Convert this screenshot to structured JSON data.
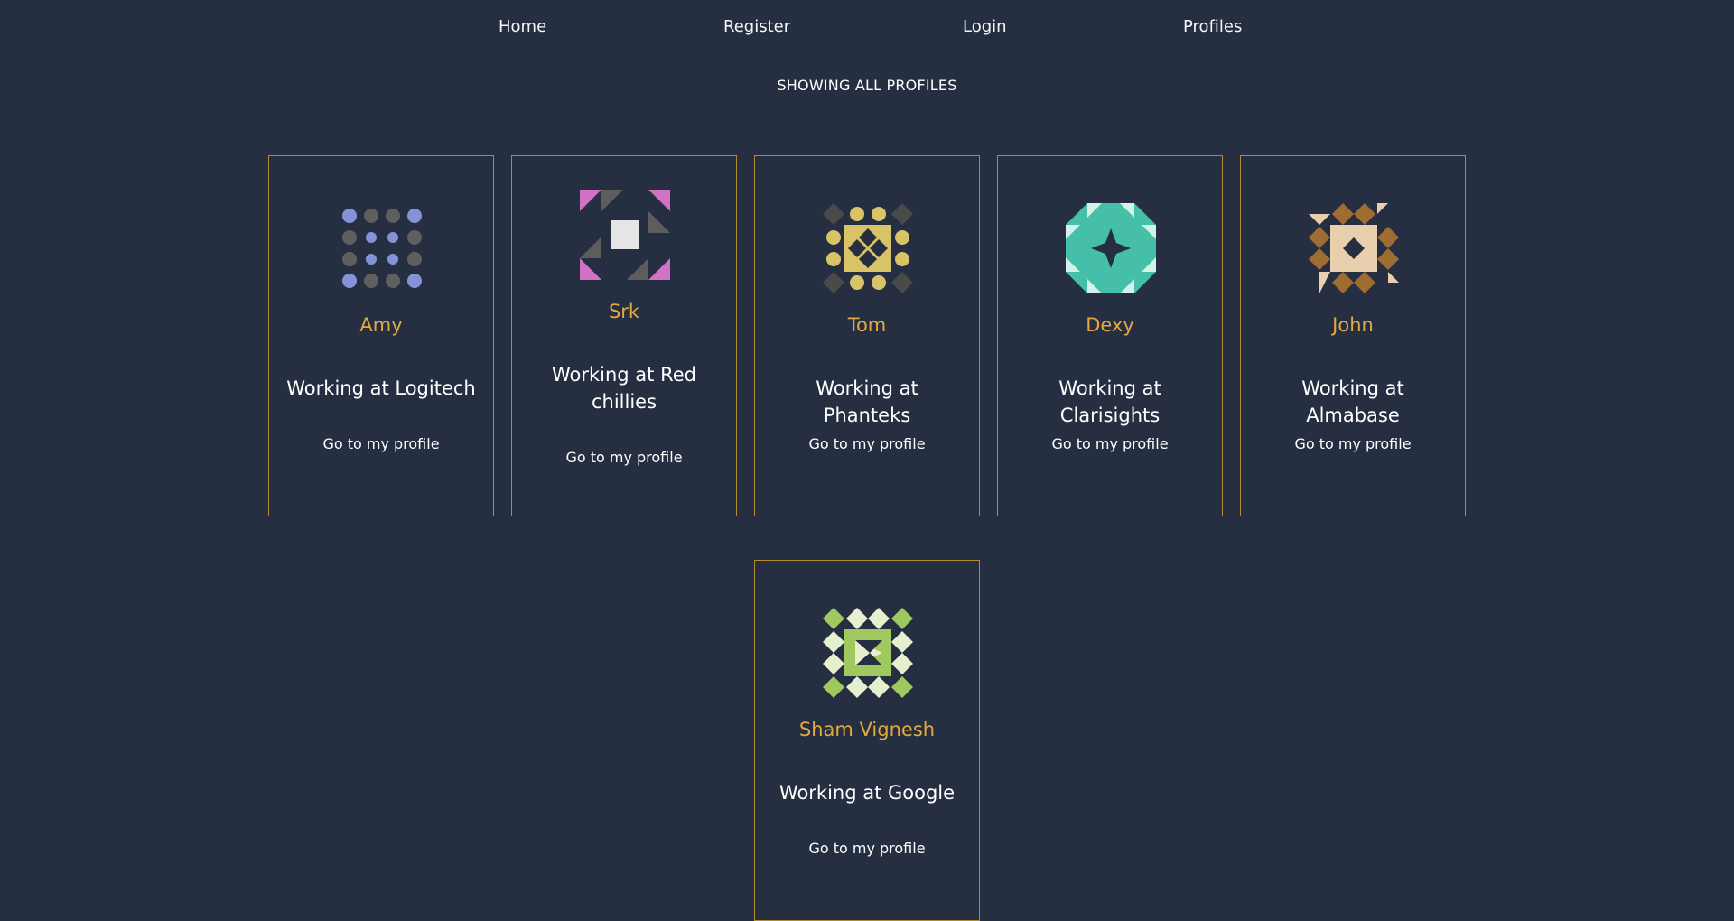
{
  "nav": {
    "home": "Home",
    "register": "Register",
    "login": "Login",
    "profiles": "Profiles"
  },
  "page": {
    "heading": "SHOWING ALL PROFILES"
  },
  "profiles": [
    {
      "name": "Amy",
      "work": "Working at Logitech",
      "link": "Go to my profile",
      "avatar_icon": "dots-pattern-icon",
      "colors": [
        "#8592d6",
        "#5f5f5f"
      ]
    },
    {
      "name": "Srk",
      "work": "Working at Red chillies",
      "link": "Go to my profile",
      "avatar_icon": "triangle-square-pattern-icon",
      "colors": [
        "#d272c4",
        "#5d5d5d",
        "#e5e5e5"
      ]
    },
    {
      "name": "Tom",
      "work": "Working at Phanteks",
      "link": "Go to my profile",
      "avatar_icon": "diamond-dot-pattern-icon",
      "colors": [
        "#d8c466",
        "#4a4a4a"
      ]
    },
    {
      "name": "Dexy",
      "work": "Working at Clarisights",
      "link": "Go to my profile",
      "avatar_icon": "star-triangle-pattern-icon",
      "colors": [
        "#46bfa8",
        "#d3f2ea"
      ]
    },
    {
      "name": "John",
      "work": "Working at Almabase",
      "link": "Go to my profile",
      "avatar_icon": "diamond-triangle-pattern-icon",
      "colors": [
        "#9d6d32",
        "#e8cfae"
      ]
    },
    {
      "name": "Sham Vignesh",
      "work": "Working at Google",
      "link": "Go to my profile",
      "avatar_icon": "green-diamond-pattern-icon",
      "colors": [
        "#9fc95f",
        "#e6f0cf"
      ]
    }
  ]
}
